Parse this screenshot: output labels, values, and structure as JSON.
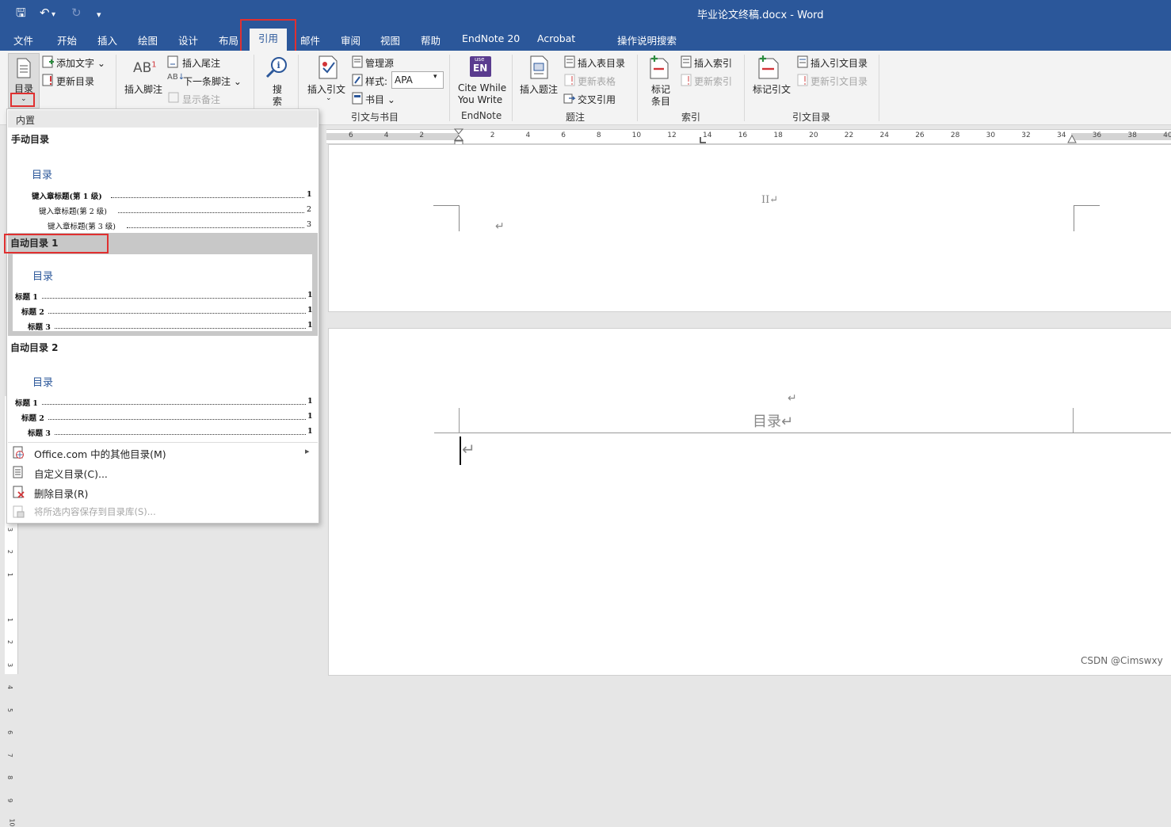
{
  "window": {
    "title": "毕业论文终稿.docx  -  Word",
    "quick_access": {
      "save": "🖫",
      "undo": "↶",
      "redo": "↻",
      "customize": "▾"
    }
  },
  "tabs": [
    {
      "label": "文件"
    },
    {
      "label": "开始"
    },
    {
      "label": "插入"
    },
    {
      "label": "绘图"
    },
    {
      "label": "设计"
    },
    {
      "label": "布局"
    },
    {
      "label": "引用",
      "active": true
    },
    {
      "label": "邮件"
    },
    {
      "label": "审阅"
    },
    {
      "label": "视图"
    },
    {
      "label": "帮助"
    },
    {
      "label": "EndNote 20"
    },
    {
      "label": "Acrobat"
    },
    {
      "label": "操作说明搜索"
    }
  ],
  "ribbon": {
    "toc": {
      "big_label": "目录",
      "add_text": "添加文字",
      "update_toc": "更新目录"
    },
    "footnotes": {
      "insert_footnote": "插入脚注",
      "insert_endnote": "插入尾注",
      "next_footnote": "下一条脚注",
      "show_notes": "显示备注",
      "ab_glyph": "AB",
      "sup": "1"
    },
    "search": {
      "label_top": "搜",
      "label_bottom": "索"
    },
    "citations": {
      "insert_citation": "插入引文",
      "manage_sources": "管理源",
      "style_label": "样式:",
      "style_value": "APA",
      "bibliography": "书目",
      "group_label": "引文与书目"
    },
    "endnote": {
      "badge_top": "use",
      "badge_main": "EN",
      "line1": "Cite While",
      "line2": "You Write",
      "group_label": "EndNote"
    },
    "captions": {
      "insert_caption": "插入题注",
      "insert_table_of_figures": "插入表目录",
      "update_table": "更新表格",
      "cross_reference": "交叉引用",
      "group_label": "题注"
    },
    "index": {
      "mark_entry_1": "标记",
      "mark_entry_2": "条目",
      "insert_index": "插入索引",
      "update_index": "更新索引",
      "group_label": "索引"
    },
    "toa": {
      "mark_citation": "标记引文",
      "insert_toa": "插入引文目录",
      "update_toa": "更新引文目录",
      "group_label": "引文目录"
    }
  },
  "ruler": {
    "ticks": [
      "6",
      "4",
      "2",
      "",
      "2",
      "4",
      "6",
      "8",
      "10",
      "12",
      "14",
      "16",
      "18",
      "20",
      "22",
      "24",
      "26",
      "28",
      "30",
      "32",
      "34",
      "36",
      "38",
      "40"
    ],
    "vticks": [
      "4",
      "3",
      "2",
      "1",
      "",
      "1",
      "2",
      "3",
      "4",
      "5",
      "6",
      "7",
      "8",
      "9",
      "10"
    ]
  },
  "dropdown": {
    "header": "内置",
    "manual": {
      "name": "手动目录",
      "title": "目录",
      "lines": [
        {
          "text": "键入章标题(第 1 级)",
          "page": "1"
        },
        {
          "text": "键入章标题(第 2 级)",
          "page": "2"
        },
        {
          "text": "键入章标题(第 3 级)",
          "page": "3"
        }
      ]
    },
    "auto1": {
      "name": "自动目录 1",
      "title": "目录",
      "lines": [
        {
          "text": "标题 1",
          "page": "1"
        },
        {
          "text": "标题 2",
          "page": "1"
        },
        {
          "text": "标题 3",
          "page": "1"
        }
      ]
    },
    "auto2": {
      "name": "自动目录 2",
      "title": "目录",
      "lines": [
        {
          "text": "标题 1",
          "page": "1"
        },
        {
          "text": "标题 2",
          "page": "1"
        },
        {
          "text": "标题 3",
          "page": "1"
        }
      ]
    },
    "menu": [
      {
        "label": "Office.com 中的其他目录(M)",
        "arrow": "▸",
        "disabled": false
      },
      {
        "label": "自定义目录(C)...",
        "disabled": false
      },
      {
        "label": "删除目录(R)",
        "disabled": false
      },
      {
        "label": "将所选内容保存到目录库(S)...",
        "disabled": true
      }
    ]
  },
  "document": {
    "page1_header": "II↵",
    "page1_para": "↵",
    "page2_para_top": "↵",
    "page2_heading": "目录↵",
    "page2_body_mark": "↵"
  },
  "watermark": "CSDN @Cimswxy",
  "colors": {
    "brand_blue": "#2b579a",
    "highlight_red": "#e03030",
    "ribbon_bg": "#f3f3f3"
  }
}
